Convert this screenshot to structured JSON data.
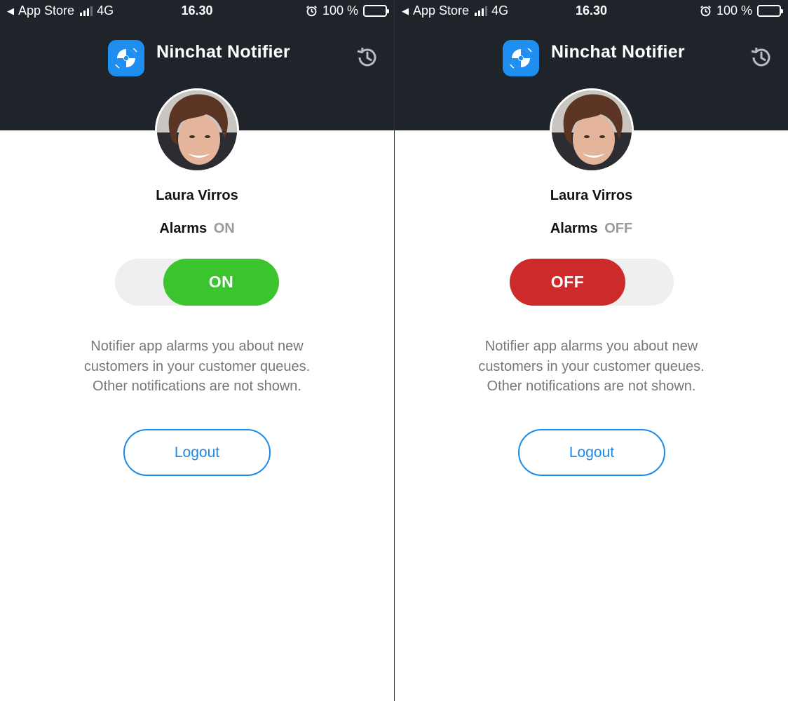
{
  "screens": [
    {
      "status_bar": {
        "back_label": "App Store",
        "network": "4G",
        "time": "16.30",
        "battery": "100 %"
      },
      "header": {
        "app_title": "Ninchat Notifier"
      },
      "profile": {
        "name": "Laura Virros"
      },
      "alarms": {
        "label": "Alarms",
        "state": "ON",
        "toggle_label": "ON",
        "toggle_color": "#3cc42e"
      },
      "description": {
        "line1": "Notifier app alarms you about new",
        "line2": "customers in your customer queues.",
        "line3": "Other notifications are not shown."
      },
      "logout_label": "Logout"
    },
    {
      "status_bar": {
        "back_label": "App Store",
        "network": "4G",
        "time": "16.30",
        "battery": "100 %"
      },
      "header": {
        "app_title": "Ninchat Notifier"
      },
      "profile": {
        "name": "Laura Virros"
      },
      "alarms": {
        "label": "Alarms",
        "state": "OFF",
        "toggle_label": "OFF",
        "toggle_color": "#cc2a2b"
      },
      "description": {
        "line1": "Notifier app alarms you about new",
        "line2": "customers in your customer queues.",
        "line3": "Other notifications are not shown."
      },
      "logout_label": "Logout"
    }
  ],
  "colors": {
    "header_bg": "#1f242b",
    "brand_blue": "#1e8ff0",
    "link_blue": "#1c8ae8",
    "text_muted": "#777777"
  },
  "icons": {
    "back": "back-triangle-icon",
    "signal": "cellular-signal-icon",
    "alarm": "alarm-clock-icon",
    "battery": "battery-icon",
    "logo": "ninchat-logo-icon",
    "history": "history-icon"
  }
}
